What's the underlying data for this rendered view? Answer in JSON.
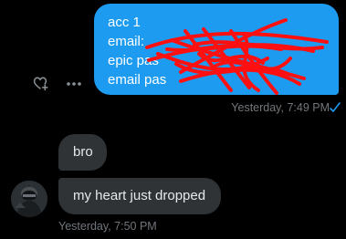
{
  "outgoing": {
    "lines": [
      "acc 1",
      "email: ",
      "epic pas",
      "email pas"
    ],
    "timestamp": "Yesterday, 7:49 PM",
    "status_icon": "sent-check-icon"
  },
  "incoming": {
    "messages": [
      "bro",
      "my heart just dropped"
    ],
    "timestamp": "Yesterday, 7:50 PM"
  },
  "icons": {
    "reaction": "heart-plus-icon",
    "more": "more-horizontal-icon"
  },
  "colors": {
    "background": "#000000",
    "outgoing_bubble": "#1d9bf0",
    "incoming_bubble": "#2f3336",
    "redaction": "#ff0000",
    "timestamp": "#71767b",
    "check": "#1d9bf0"
  }
}
